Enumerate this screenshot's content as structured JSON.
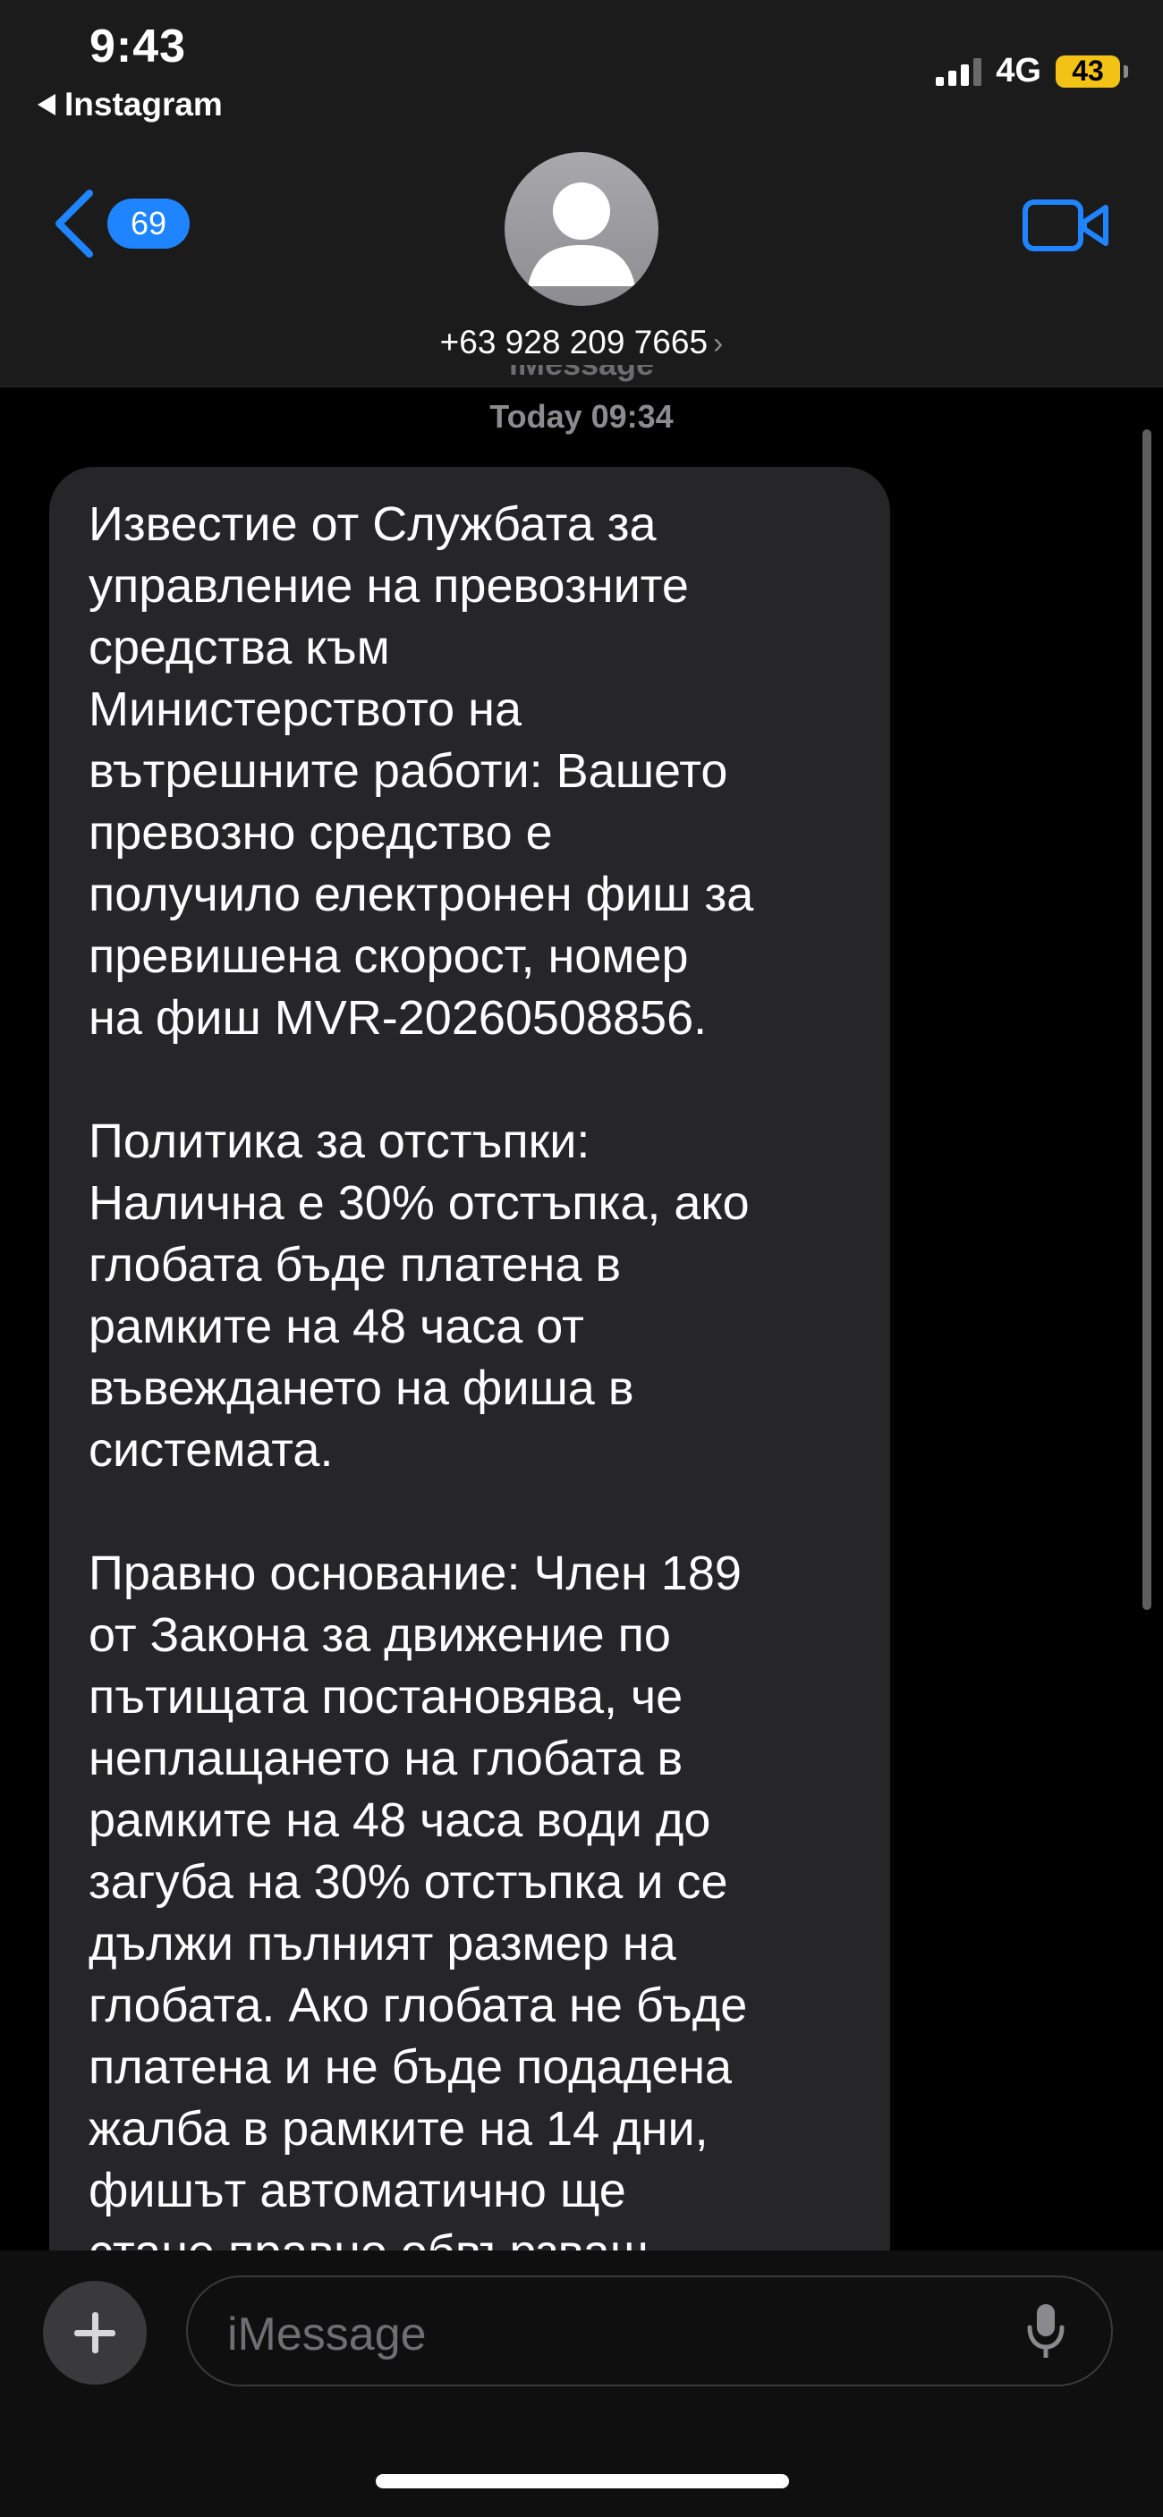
{
  "status_bar": {
    "time": "9:43",
    "back_app": "Instagram",
    "network": "4G",
    "battery": "43"
  },
  "header": {
    "back_count": "69",
    "contact": "+63 928 209 7665",
    "contact_chevron": "›"
  },
  "thread": {
    "service_label": "iMessage",
    "timestamp": "Today 09:34"
  },
  "message": {
    "paragraphs": [
      "Известие от Службата за\nуправление на превозните\nсредства към\nМинистерството на\nвътрешните работи: Вашето\nпревозно средство е\nполучило електронен фиш за\nпревишена скорост, номер\nна фиш MVR-20260508856.",
      "Политика за отстъпки:\nНалична е 30% отстъпка, ако\nглобата бъде платена в\nрамките на 48 часа от\nвъвеждането на фиша в\nсистемата.",
      "Правно основание: Член 189\nот Закона за движение по\nпътищата постановява, че\nнеплащането на глобата в\nрамките на 48 часа води до\nзагуба на 30% отстъпка и се\nдължи пълният размер на\nглобата. Ако глобата не бъде\nплатена и не бъде подадена\nжалба в рамките на 14 дни,\nфишът автоматично ще\nстане правно обвързващ"
    ]
  },
  "composer": {
    "placeholder": "iMessage"
  },
  "colors": {
    "accent": "#1f84ff",
    "bubble": "#262629",
    "battery": "#f2c315"
  },
  "icons": [
    "back-arrow-icon",
    "chevron-left-icon",
    "avatar-icon",
    "video-camera-icon",
    "plus-icon",
    "microphone-icon",
    "signal-icon",
    "battery-icon"
  ]
}
